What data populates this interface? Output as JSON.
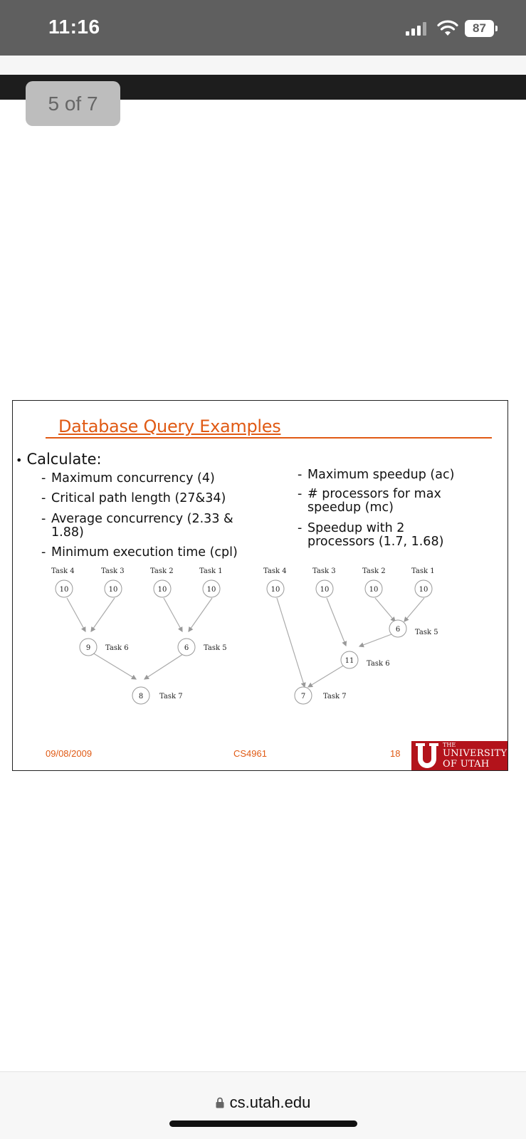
{
  "status_bar": {
    "time": "11:16",
    "battery": "87"
  },
  "viewer": {
    "page_indicator": "5 of 7"
  },
  "slide": {
    "title": "Database Query Examples",
    "bullet": "Calculate:",
    "left_items": [
      {
        "dash": "-",
        "line1": "Maximum concurrency (4)",
        "line2": ""
      },
      {
        "dash": "-",
        "line1": "Critical path length (27&34)",
        "line2": ""
      },
      {
        "dash": "-",
        "line1": "Average concurrency (2.33 &",
        "line2": "1.88)"
      },
      {
        "dash": "-",
        "line1": "Minimum execution time (cpl)",
        "line2": ""
      }
    ],
    "right_items": [
      {
        "dash": "-",
        "line1": "Maximum speedup (ac)",
        "line2": ""
      },
      {
        "dash": "-",
        "line1": "# processors for max",
        "line2": "speedup (mc)"
      },
      {
        "dash": "-",
        "line1": "Speedup with 2",
        "line2": "processors (1.7, 1.68)"
      }
    ],
    "graph_left": {
      "top_labels": [
        "Task 4",
        "Task 3",
        "Task 2",
        "Task 1"
      ],
      "top_values": [
        "10",
        "10",
        "10",
        "10"
      ],
      "mid_values": [
        "9",
        "6"
      ],
      "mid_labels": [
        "Task 6",
        "Task 5"
      ],
      "bottom_value": "8",
      "bottom_label": "Task 7"
    },
    "graph_right": {
      "top_labels": [
        "Task 4",
        "Task 3",
        "Task 2",
        "Task 1"
      ],
      "top_values": [
        "10",
        "10",
        "10",
        "10"
      ],
      "task5_value": "6",
      "task5_label": "Task 5",
      "task6_value": "11",
      "task6_label": "Task 6",
      "task7_value": "7",
      "task7_label": "Task 7"
    },
    "footer": {
      "date": "09/08/2009",
      "course": "CS4961",
      "page": "18"
    },
    "logo": {
      "the": "THE",
      "line1": "UNIVERSITY",
      "line2": "OF UTAH"
    }
  },
  "browser": {
    "url": "cs.utah.edu"
  },
  "colors": {
    "title_orange": "#e05a14",
    "utah_red": "#b3131b",
    "status_bar": "#5f5f5f"
  }
}
